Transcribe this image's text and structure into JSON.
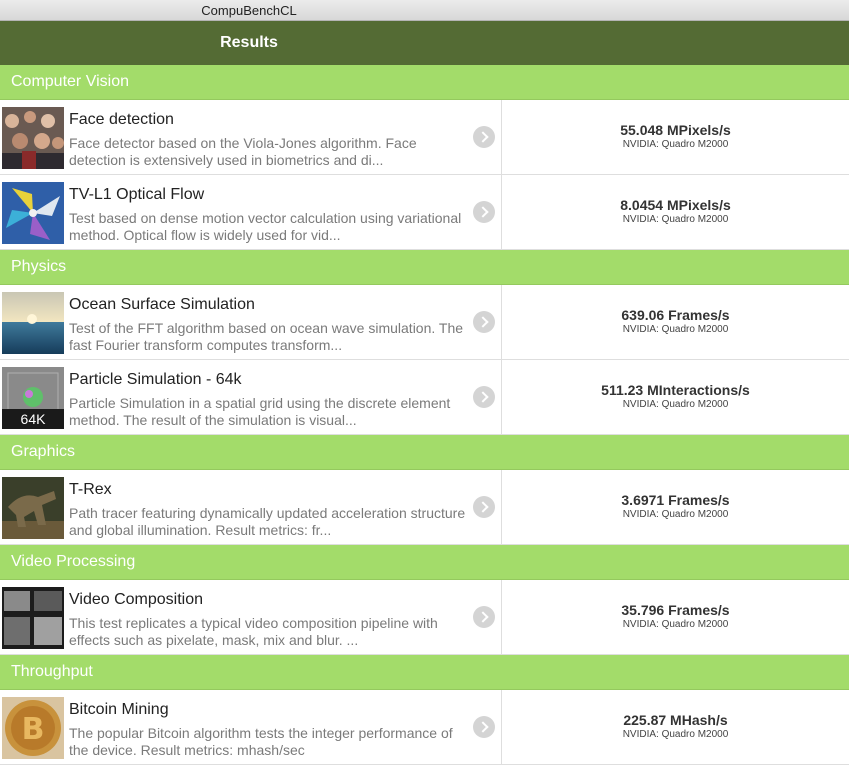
{
  "window": {
    "title": "CompuBenchCL"
  },
  "header": {
    "title": "Results"
  },
  "sections": [
    {
      "title": "Computer Vision",
      "tests": [
        {
          "name": "Face detection",
          "description": "Face detector based on the Viola-Jones algorithm. Face detection is extensively used in biometrics and di...",
          "score": "55.048 MPixels/s",
          "device": "NVIDIA: Quadro M2000",
          "thumb_icon": "crowd-faces-thumbnail",
          "thumb_label": ""
        },
        {
          "name": "TV-L1 Optical Flow",
          "description": "Test based on dense motion vector calculation using variational method. Optical flow is widely used for vid...",
          "score": "8.0454 MPixels/s",
          "device": "NVIDIA: Quadro M2000",
          "thumb_icon": "pinwheel-thumbnail",
          "thumb_label": ""
        }
      ]
    },
    {
      "title": "Physics",
      "tests": [
        {
          "name": "Ocean Surface Simulation",
          "description": "Test of the FFT algorithm based on ocean wave simulation. The fast Fourier transform computes transform...",
          "score": "639.06 Frames/s",
          "device": "NVIDIA: Quadro M2000",
          "thumb_icon": "ocean-thumbnail",
          "thumb_label": ""
        },
        {
          "name": "Particle Simulation - 64k",
          "description": "Particle Simulation in a spatial grid using the discrete element method. The result of the simulation is visual...",
          "score": "511.23 MInteractions/s",
          "device": "NVIDIA: Quadro M2000",
          "thumb_icon": "particle-sphere-thumbnail",
          "thumb_label": "64K"
        }
      ]
    },
    {
      "title": "Graphics",
      "tests": [
        {
          "name": "T-Rex",
          "description": "Path tracer featuring dynamically updated acceleration structure and global illumination. Result metrics: fr...",
          "score": "3.6971 Frames/s",
          "device": "NVIDIA: Quadro M2000",
          "thumb_icon": "trex-thumbnail",
          "thumb_label": ""
        }
      ]
    },
    {
      "title": "Video Processing",
      "tests": [
        {
          "name": "Video Composition",
          "description": "This test replicates a typical video composition pipeline with effects such as pixelate, mask, mix and blur. ...",
          "score": "35.796 Frames/s",
          "device": "NVIDIA: Quadro M2000",
          "thumb_icon": "video-frames-thumbnail",
          "thumb_label": ""
        }
      ]
    },
    {
      "title": "Throughput",
      "tests": [
        {
          "name": "Bitcoin Mining",
          "description": "The popular Bitcoin algorithm tests the integer performance of the device. Result metrics: mhash/sec",
          "score": "225.87 MHash/s",
          "device": "NVIDIA: Quadro M2000",
          "thumb_icon": "bitcoin-coin-thumbnail",
          "thumb_label": ""
        }
      ]
    }
  ],
  "colors": {
    "header": "#546b34",
    "section": "#a3dc6a",
    "chevron": "#d4d4d4"
  }
}
